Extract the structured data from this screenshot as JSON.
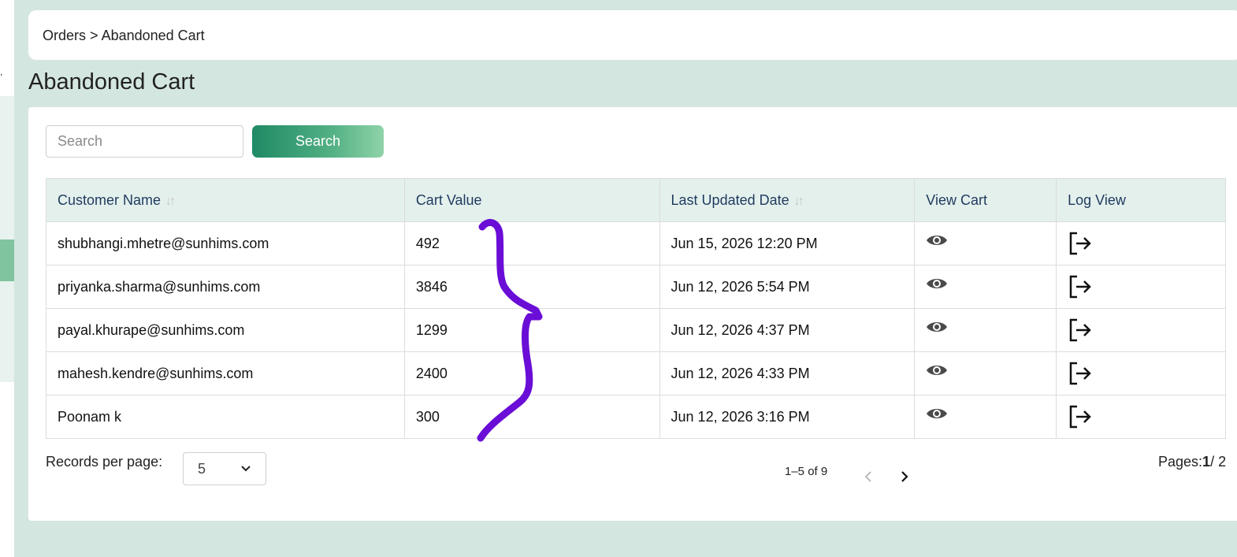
{
  "breadcrumb": {
    "parent": "Orders",
    "separator": ">",
    "current": "Abandoned Cart"
  },
  "page": {
    "title": "Abandoned Cart"
  },
  "search": {
    "placeholder": "Search",
    "button_label": "Search"
  },
  "table": {
    "headers": [
      "Customer Name",
      "Cart Value",
      "Last Updated Date",
      "View Cart",
      "Log View"
    ],
    "rows": [
      {
        "customer": "shubhangi.mhetre@sunhims.com",
        "value": "492",
        "date": "Jun 15, 2026 12:20 PM"
      },
      {
        "customer": "priyanka.sharma@sunhims.com",
        "value": "3846",
        "date": "Jun 12, 2026 5:54 PM"
      },
      {
        "customer": "payal.khurape@sunhims.com",
        "value": "1299",
        "date": "Jun 12, 2026 4:37 PM"
      },
      {
        "customer": "mahesh.kendre@sunhims.com",
        "value": "2400",
        "date": "Jun 12, 2026 4:33 PM"
      },
      {
        "customer": "Poonam k",
        "value": "300",
        "date": "Jun 12, 2026 3:16 PM"
      }
    ],
    "view_icon": "eye-icon",
    "log_icon": "logout-arrow-icon"
  },
  "pagination": {
    "records_label": "Records per page:",
    "records_value": "5",
    "range": "1–5 of 9",
    "pages_label": "Pages:",
    "current_page": "1",
    "total_pages": "/ 2"
  },
  "colors": {
    "accent": "#2e9a72",
    "header_bg": "#e4f0ec",
    "page_bg": "#d4e6e0",
    "annotation": "#6a0dd6"
  }
}
